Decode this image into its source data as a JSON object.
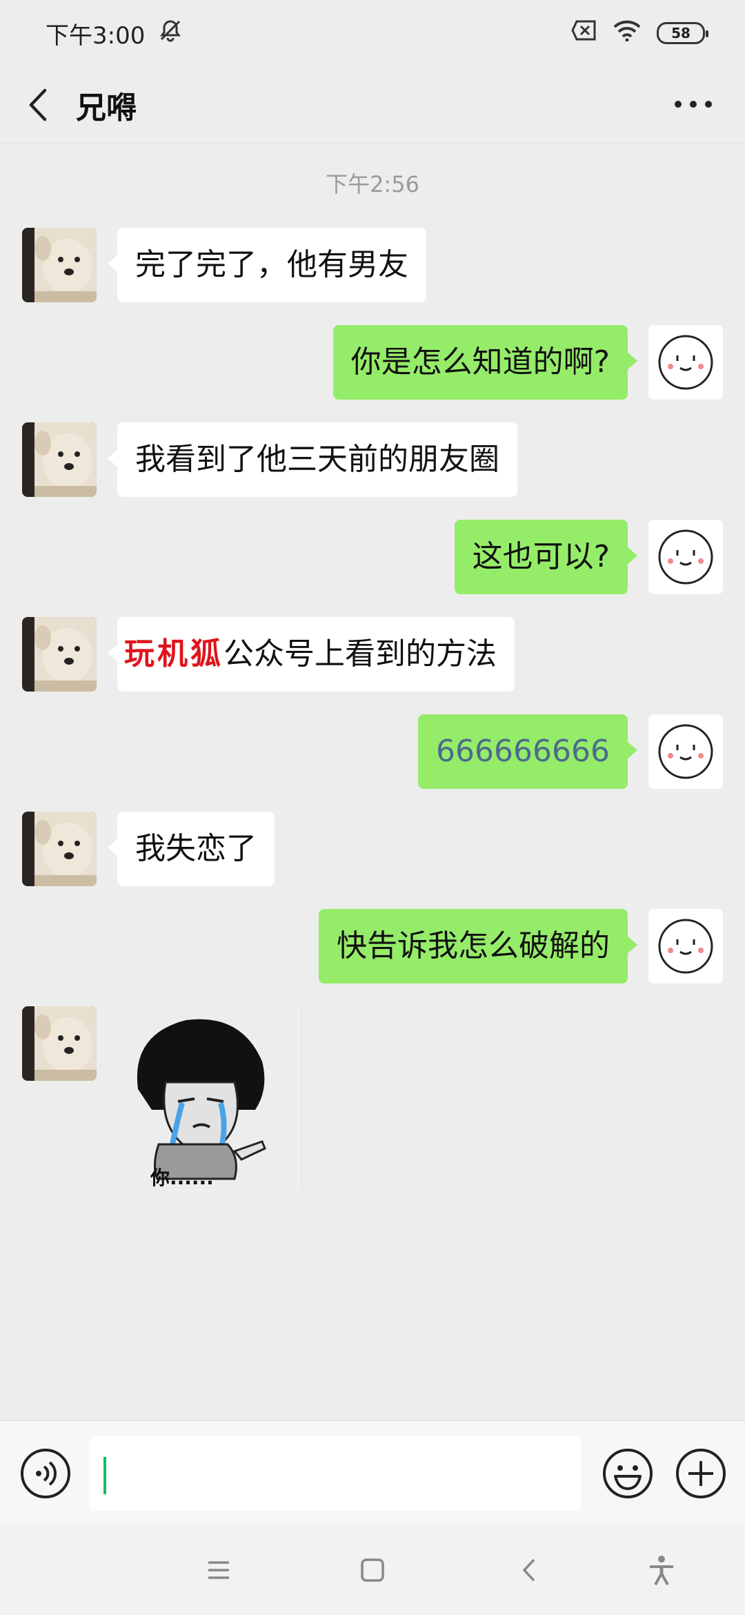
{
  "status_bar": {
    "time": "下午3:00",
    "battery": "58"
  },
  "header": {
    "title": "兄嘚"
  },
  "chat": {
    "timestamp": "下午2:56",
    "messages": [
      {
        "side": "left",
        "text": "完了完了，他有男友"
      },
      {
        "side": "right",
        "text": "你是怎么知道的啊?"
      },
      {
        "side": "left",
        "text": "我看到了他三天前的朋友圈"
      },
      {
        "side": "right",
        "text": "这也可以?"
      },
      {
        "side": "left",
        "highlight": "玩机狐",
        "text": "公众号上看到的方法"
      },
      {
        "side": "right",
        "text": "666666666"
      },
      {
        "side": "left",
        "text": "我失恋了"
      },
      {
        "side": "right",
        "text": "快告诉我怎么破解的"
      }
    ],
    "sticker_caption": "你......"
  },
  "colors": {
    "sent_bubble": "#95ec69",
    "received_bubble": "#ffffff",
    "accent": "#07c160",
    "highlight": "#e0141c"
  },
  "input_bar": {
    "value": ""
  },
  "icons": [
    "back-icon",
    "more-icon",
    "mute-icon",
    "sim-icon",
    "wifi-icon",
    "voice-icon",
    "emoji-icon",
    "plus-icon",
    "menu-icon",
    "home-icon",
    "nav-back-icon",
    "accessibility-icon"
  ]
}
